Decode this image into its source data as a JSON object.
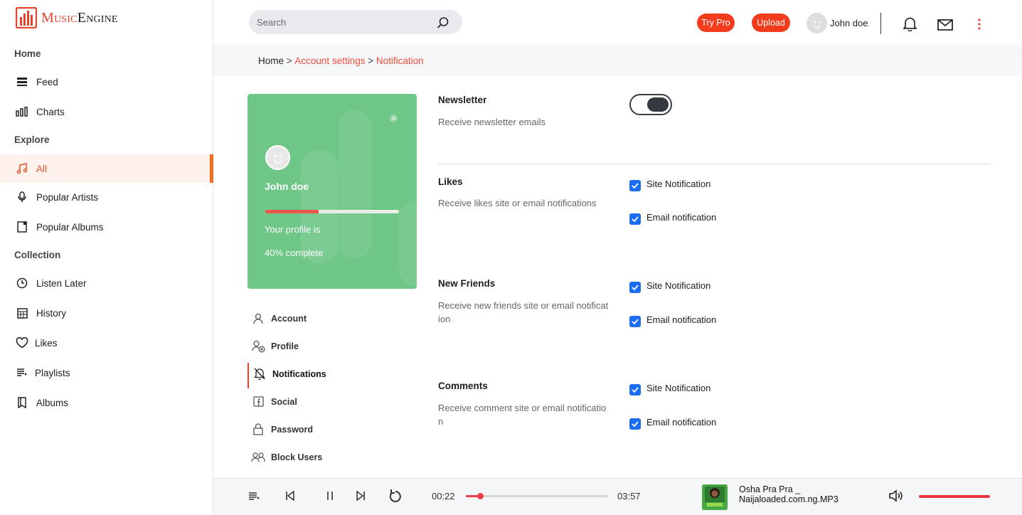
{
  "app": {
    "logo_first": "Music",
    "logo_second": "Engine",
    "brand_color": "#e8422d"
  },
  "sidebar": {
    "sections": [
      {
        "label": "Home"
      },
      {
        "label": "Explore"
      },
      {
        "label": "Collection"
      }
    ],
    "items": [
      {
        "label": "Feed",
        "icon": "feed-icon"
      },
      {
        "label": "Charts",
        "icon": "charts-icon"
      },
      {
        "label": "All",
        "icon": "music-note-icon",
        "active": true
      },
      {
        "label": "Popular Artists",
        "icon": "microphone-icon"
      },
      {
        "label": "Popular Albums",
        "icon": "album-icon"
      },
      {
        "label": "Listen Later",
        "icon": "clock-icon"
      },
      {
        "label": "History",
        "icon": "calendar-icon"
      },
      {
        "label": "Likes",
        "icon": "heart-icon"
      },
      {
        "label": "Playlists",
        "icon": "playlist-icon"
      },
      {
        "label": "Albums",
        "icon": "book-icon"
      }
    ]
  },
  "topbar": {
    "search_placeholder": "Search",
    "try_pro": "Try Pro",
    "upload": "Upload",
    "user_name": "John doe"
  },
  "breadcrumb": {
    "home": "Home",
    "sep": " > ",
    "account": "Account settings",
    "current": "Notification"
  },
  "profile_card": {
    "name": "John doe",
    "progress": 0.4,
    "line1": "Your profile is",
    "line2": "40% complete",
    "progress_color": "#f0564a",
    "card_color": "#6ec687"
  },
  "settings_nav": [
    {
      "label": "Account",
      "icon": "user-icon"
    },
    {
      "label": "Profile",
      "icon": "user-add-icon"
    },
    {
      "label": "Notifications",
      "icon": "bell-off-icon",
      "active": true
    },
    {
      "label": "Social",
      "icon": "facebook-icon"
    },
    {
      "label": "Password",
      "icon": "lock-icon"
    },
    {
      "label": "Block Users",
      "icon": "users-icon"
    }
  ],
  "notifications": {
    "newsletter": {
      "title": "Newsletter",
      "desc": "Receive newsletter emails",
      "enabled": true
    },
    "groups": [
      {
        "title": "Likes",
        "desc": "Receive likes site or email notifications",
        "site_label": "Site Notification",
        "email_label": "Email notification",
        "site": true,
        "email": true
      },
      {
        "title": "New Friends",
        "desc": "Receive new friends site or email notification",
        "site_label": "Site Notification",
        "email_label": "Email notification",
        "site": true,
        "email": true
      },
      {
        "title": "Comments",
        "desc": "Receive comment site or email notification",
        "site_label": "Site Notification",
        "email_label": "Email notification",
        "site": true,
        "email": true
      }
    ]
  },
  "player": {
    "elapsed": "00:22",
    "duration": "03:57",
    "progress": 0.1,
    "song_title": "Osha Pra Pra _ Naijaloaded.com.ng.MP3",
    "volume": 1.0,
    "accent": "#ef3e4a"
  }
}
